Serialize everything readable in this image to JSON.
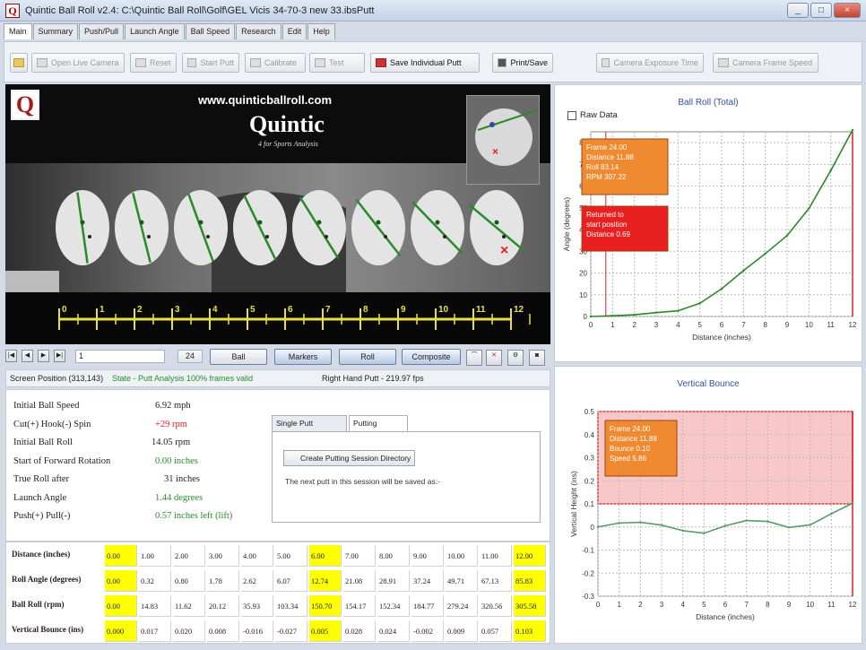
{
  "window": {
    "title": "Quintic Ball Roll v2.4: C:\\Quintic Ball Roll\\Golf\\GEL Vicis 34-70-3 new 33.ibsPutt",
    "buttons": [
      "_",
      "□",
      "×"
    ]
  },
  "tabs": [
    "Main",
    "Summary",
    "Push/Pull",
    "Launch Angle",
    "Ball Speed",
    "Research",
    "Edit",
    "Help"
  ],
  "toolbar": {
    "open_live_camera": "Open Live Camera",
    "reset": "Reset",
    "start_putt": "Start Putt",
    "calibrate": "Calibrate",
    "test": "Test",
    "save_individual_putt": "Save Individual Putt",
    "print_save": "Print/Save",
    "camera_exposure_time": "Camera Exposure Time",
    "camera_frame_speed": "Camera Frame Speed"
  },
  "video": {
    "url": "www.quinticballroll.com",
    "logo_letter": "Q",
    "brand": "Quintic",
    "brand_sub": "4 for Sports Analysis",
    "ruler_labels": [
      "0",
      "1",
      "2",
      "3",
      "4",
      "5",
      "6",
      "7",
      "8",
      "9",
      "10",
      "11",
      "12"
    ]
  },
  "video_controls": {
    "frame_value": "1",
    "frame_number": "24",
    "ball": "Ball",
    "markers": "Markers",
    "roll": "Roll",
    "composite": "Composite"
  },
  "status": {
    "screen_position": "Screen Position (313,143)",
    "state": "State - Putt Analysis 100% frames valid",
    "putt_info": "Right Hand Putt - 219.97 fps"
  },
  "metrics": [
    {
      "label": "Initial Ball Speed",
      "value": "6.92 mph",
      "color": "#222222"
    },
    {
      "label": "Cut(+) Hook(-) Spin",
      "value": "+29 rpm",
      "color": "#e02020"
    },
    {
      "label": "Initial Ball Roll",
      "value": "14.05 rpm",
      "color": "#222222"
    },
    {
      "label": "Start of Forward Rotation",
      "value": "0.00 inches",
      "color": "#2a8a2a"
    },
    {
      "label": "True Roll after",
      "value": "31 inches",
      "color": "#222222"
    },
    {
      "label": "Launch Angle",
      "value": "1.44 degrees",
      "color": "#2a8a2a"
    },
    {
      "label": "Push(+) Pull(-)",
      "value": "0.57 inches left (lift)",
      "color": "#2a8a2a"
    }
  ],
  "session": {
    "tab_single": "Single Putt Analysis",
    "tab_session": "Putting Session",
    "create_button": "Create Putting Session Directory",
    "next_text": "The next putt in this session will be saved as:-"
  },
  "grid": {
    "rows": [
      {
        "label": "Distance     (inches)",
        "values": [
          "0.00",
          "1.00",
          "2.00",
          "3.00",
          "4.00",
          "5.00",
          "6.00",
          "7.00",
          "8.00",
          "9.00",
          "10.00",
          "11.00",
          "12.00"
        ]
      },
      {
        "label": "Roll Angle  (degrees)",
        "values": [
          "0.00",
          "0.32",
          "0.80",
          "1.78",
          "2.62",
          "6.07",
          "12.74",
          "21.08",
          "28.91",
          "37.24",
          "49.71",
          "67.13",
          "85.83"
        ]
      },
      {
        "label": "Ball Roll            (rpm)",
        "values": [
          "0.00",
          "14.83",
          "11.62",
          "20.12",
          "35.93",
          "103.34",
          "150.70",
          "154.17",
          "152.34",
          "184.77",
          "279.24",
          "320.56",
          "305.58"
        ]
      },
      {
        "label": "Vertical Bounce (ins)",
        "values": [
          "0.000",
          "0.017",
          "0.020",
          "0.008",
          "-0.016",
          "-0.027",
          "0.005",
          "0.028",
          "0.024",
          "-0.002",
          "0.009",
          "0.057",
          "0.103"
        ]
      }
    ],
    "highlight_columns": [
      0,
      6,
      12
    ]
  },
  "chart_data": [
    {
      "type": "line",
      "title": "Ball Roll (Total)",
      "xlabel": "Distance (inches)",
      "ylabel": "Angle (degrees)",
      "xlim": [
        0,
        12
      ],
      "ylim": [
        0,
        85
      ],
      "x_ticks": [
        0,
        1,
        2,
        3,
        4,
        5,
        6,
        7,
        8,
        9,
        10,
        11,
        12
      ],
      "y_ticks": [
        0,
        10,
        20,
        30,
        40,
        50,
        60,
        70,
        80
      ],
      "grid": true,
      "raw_data_label": "Raw Data",
      "series": [
        {
          "color": "#2a8a2a",
          "x": [
            0,
            1,
            2,
            3,
            4,
            5,
            6,
            7,
            8,
            9,
            10,
            11,
            12
          ],
          "y": [
            0,
            0.32,
            0.8,
            1.78,
            2.62,
            6.07,
            12.74,
            21.08,
            28.91,
            37.24,
            49.71,
            67.13,
            85.83
          ]
        }
      ],
      "annotations": [
        {
          "lines": [
            "Frame   24.00",
            "Distance   11.88",
            "Roll   83.14",
            "RPM   307.22"
          ],
          "color": "#f08a30"
        },
        {
          "lines": [
            "Returned to",
            "start position",
            "Distance   0.69"
          ],
          "color": "#e82020"
        }
      ]
    },
    {
      "type": "line",
      "title": "Vertical Bounce",
      "xlabel": "Distance (inches)",
      "ylabel": "Vertical Height (ins)",
      "xlim": [
        0,
        12
      ],
      "ylim": [
        -0.3,
        0.5
      ],
      "x_ticks": [
        0,
        1,
        2,
        3,
        4,
        5,
        6,
        7,
        8,
        9,
        10,
        11,
        12
      ],
      "y_ticks": [
        -0.3,
        -0.2,
        -0.1,
        0,
        0.1,
        0.2,
        0.3,
        0.4,
        0.5
      ],
      "grid": true,
      "shaded_band": [
        0.1,
        0.5
      ],
      "series": [
        {
          "color": "#5a9a6a",
          "x": [
            0,
            1,
            2,
            3,
            4,
            5,
            6,
            7,
            8,
            9,
            10,
            11,
            12
          ],
          "y": [
            0,
            0.017,
            0.02,
            0.008,
            -0.016,
            -0.027,
            0.005,
            0.028,
            0.024,
            -0.002,
            0.009,
            0.057,
            0.103
          ]
        }
      ],
      "annotations": [
        {
          "lines": [
            "Frame   24.00",
            "Distance   11.88",
            "Bounce   0.10",
            "Speed   5.86"
          ],
          "color": "#f08a30"
        }
      ]
    }
  ]
}
